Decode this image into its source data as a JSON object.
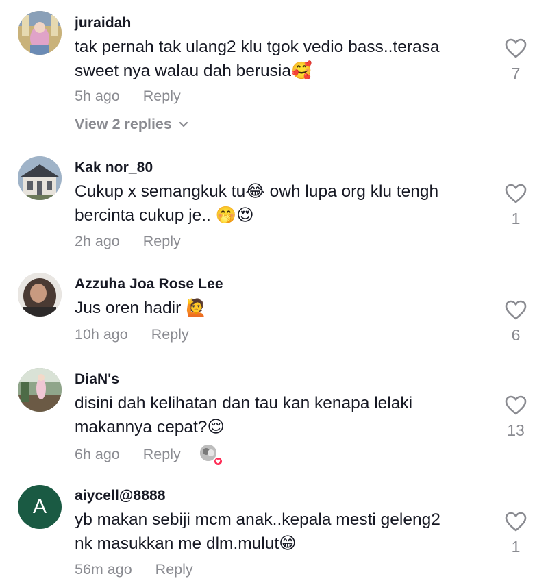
{
  "comments": [
    {
      "username": "juraidah",
      "text": "tak pernah tak ulang2 klu tgok vedio bass..terasa\nsweet nya walau dah berusia🥰",
      "time": "5h ago",
      "reply": "Reply",
      "likes": "7",
      "view_replies": "View 2 replies"
    },
    {
      "username": "Kak nor_80",
      "text": "Cukup x semangkuk tu😂 owh lupa org klu tengh\nbercinta cukup je.. 🤭😍",
      "time": "2h ago",
      "reply": "Reply",
      "likes": "1"
    },
    {
      "username": "Azzuha Joa Rose Lee",
      "text": "Jus oren hadir 🙋",
      "time": "10h ago",
      "reply": "Reply",
      "likes": "6"
    },
    {
      "username": "DiaN's",
      "text": "disini dah kelihatan dan tau kan kenapa lelaki\nmakannya cepat?😌",
      "time": "6h ago",
      "reply": "Reply",
      "likes": "13"
    },
    {
      "username": "aiycell@8888",
      "avatar_letter": "A",
      "text": "yb makan sebiji mcm anak..kepala mesti geleng2\nnk masukkan me dlm.mulut😁",
      "time": "56m ago",
      "reply": "Reply",
      "likes": "1"
    }
  ],
  "icons": {
    "like": "heart-outline-icon",
    "expand": "chevron-down-icon",
    "creator_liked": "heart-badge-icon"
  },
  "colors": {
    "text_primary": "#161823",
    "text_secondary": "#8a8b91",
    "heart_badge": "#fe2c55",
    "avatar_letter_bg": "#1a5a43"
  }
}
